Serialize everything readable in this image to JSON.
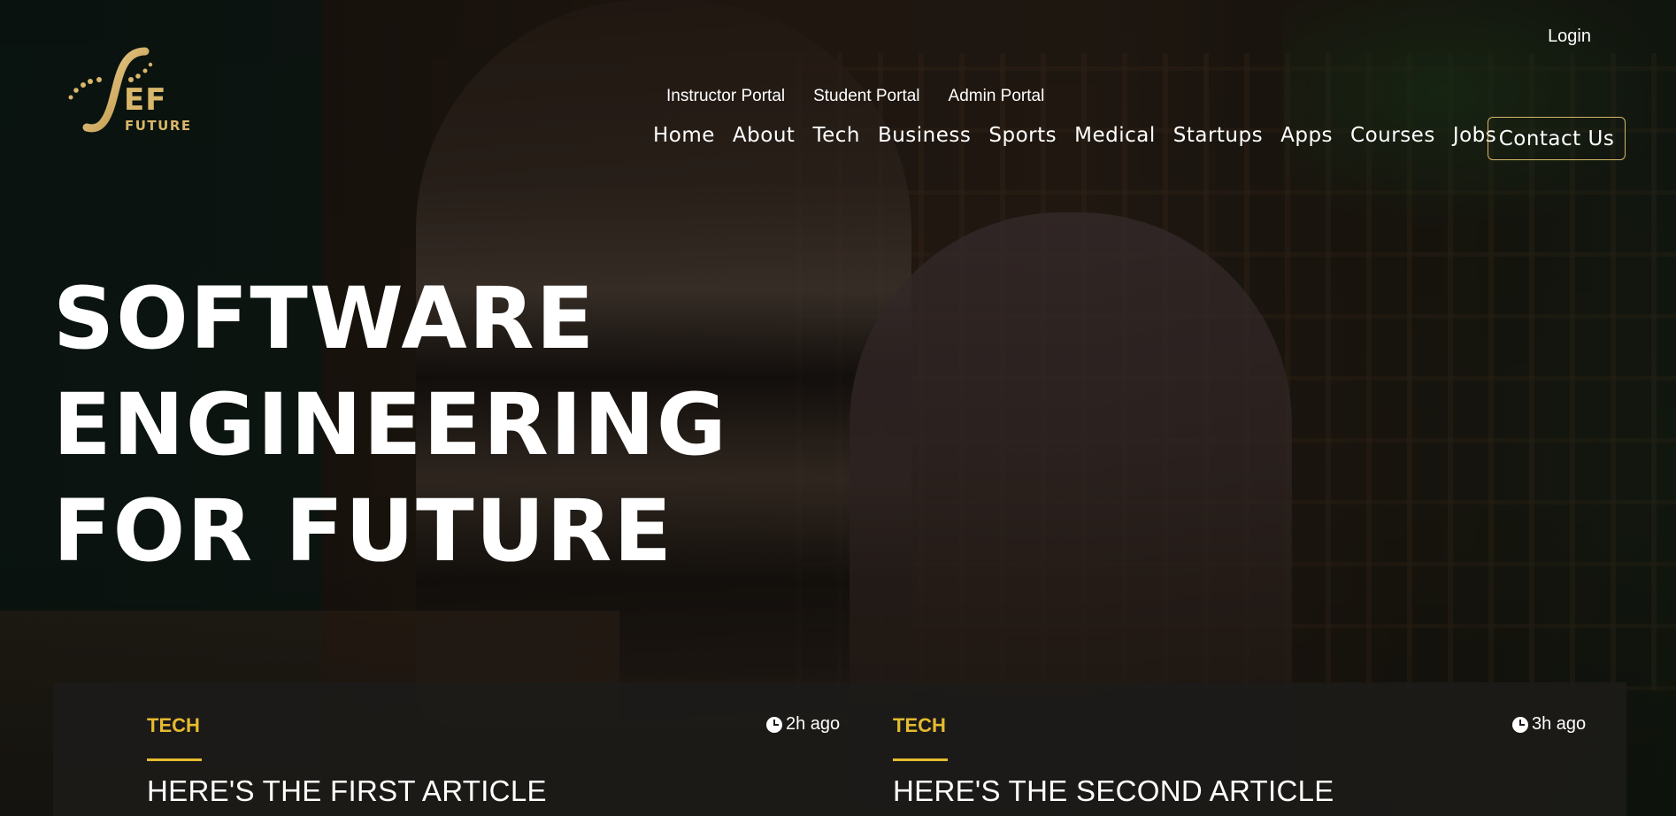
{
  "header": {
    "logo": {
      "primary": "EF",
      "secondary": "FUTURE"
    },
    "login_label": "Login",
    "portals": [
      "Instructor Portal",
      "Student Portal",
      "Admin Portal"
    ],
    "nav": [
      "Home",
      "About",
      "Tech",
      "Business",
      "Sports",
      "Medical",
      "Startups",
      "Apps",
      "Courses",
      "Jobs"
    ],
    "contact_label": "Contact Us"
  },
  "hero": {
    "headline_lines": [
      "SOFTWARE",
      "ENGINEERING",
      "FOR FUTURE"
    ]
  },
  "articles": [
    {
      "category": "TECH",
      "time": "2h ago",
      "title": "HERE'S THE FIRST ARTICLE"
    },
    {
      "category": "TECH",
      "time": "3h ago",
      "title": "HERE'S THE SECOND ARTICLE"
    }
  ],
  "colors": {
    "accent_gold": "#d8b66a",
    "category_yellow": "#e5bb2f"
  }
}
